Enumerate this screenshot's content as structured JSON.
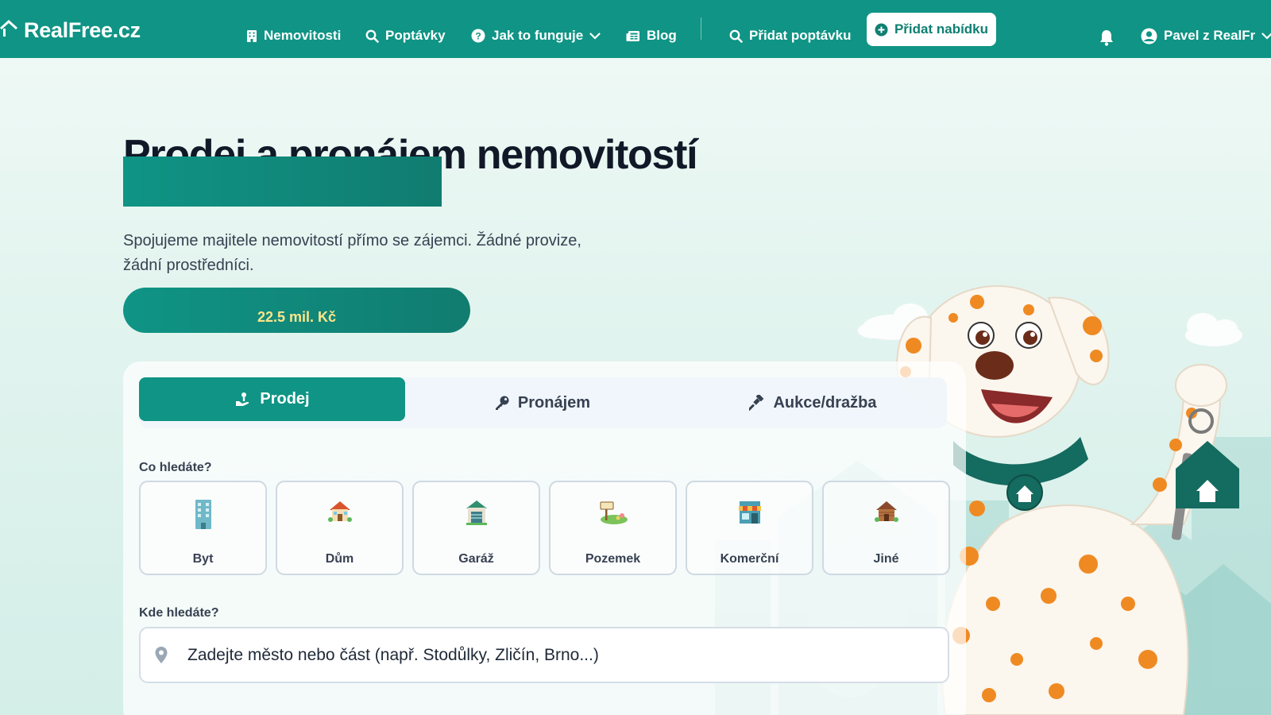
{
  "header": {
    "logo_text": "RealFree.cz",
    "nav": [
      {
        "label": "Nemovitosti",
        "icon": "building-icon"
      },
      {
        "label": "Poptávky",
        "icon": "search-icon"
      },
      {
        "label": "Jak to funguje",
        "icon": "help-circle-icon"
      },
      {
        "label": "Blog",
        "icon": "newspaper-icon"
      }
    ],
    "add_request": {
      "label": "Přidat poptávku",
      "icon": "search-icon"
    },
    "add_offer": {
      "label": "Přidat nabídku",
      "icon": "plus-circle-icon"
    },
    "user": {
      "label": "Pavel z RealFr",
      "icon": "user-circle-icon"
    },
    "bell_icon": "bell-icon"
  },
  "hero": {
    "title": "Prodej a pronájem nemovitostí",
    "subtitle_line1": "Spojujeme majitele nemovitostí přímo se zájemci. Žádné provize,",
    "subtitle_line2": "žádní prostředníci.",
    "price": "22.5 mil. Kč"
  },
  "search": {
    "tabs": [
      {
        "label": "Prodej",
        "icon": "hand-money-icon",
        "active": true
      },
      {
        "label": "Pronájem",
        "icon": "key-icon",
        "active": false
      },
      {
        "label": "Aukce/dražba",
        "icon": "gavel-icon",
        "active": false
      }
    ],
    "type_label": "Co hledáte?",
    "types": [
      {
        "label": "Byt",
        "icon": "apartment-building-icon"
      },
      {
        "label": "Dům",
        "icon": "house-icon"
      },
      {
        "label": "Garáž",
        "icon": "garage-icon"
      },
      {
        "label": "Pozemek",
        "icon": "land-plot-icon"
      },
      {
        "label": "Komerční",
        "icon": "shop-icon"
      },
      {
        "label": "Jiné",
        "icon": "cabin-icon"
      }
    ],
    "location_label": "Kde hledáte?",
    "location_placeholder": "Zadejte město nebo část (např. Stodůlky, Zličín, Brno...)"
  },
  "colors": {
    "brand": "#0f9485",
    "brand_dark": "#117c70",
    "price_text": "#fde68a"
  }
}
